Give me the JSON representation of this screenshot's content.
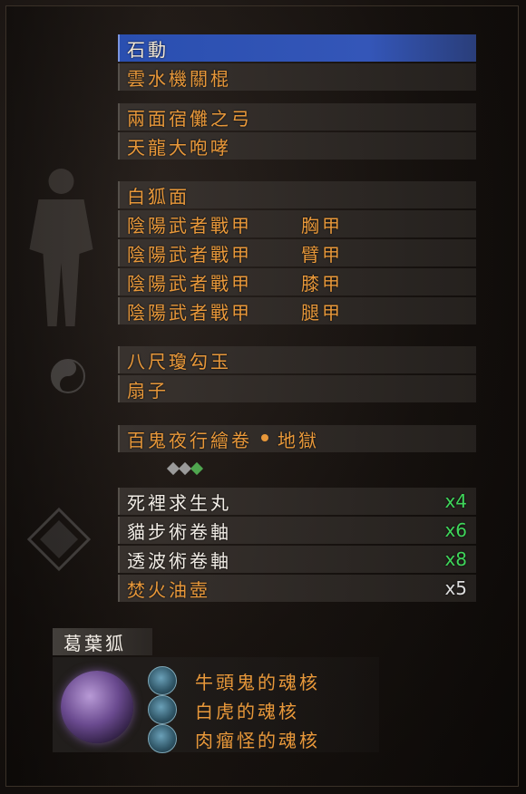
{
  "weapons": [
    "石動",
    "雲水機關棍"
  ],
  "ranged": [
    "兩面宿儺之弓",
    "天龍大咆哮"
  ],
  "armor": [
    {
      "name": "白狐面",
      "part": ""
    },
    {
      "name": "陰陽武者戰甲",
      "part": "胸甲"
    },
    {
      "name": "陰陽武者戰甲",
      "part": "臂甲"
    },
    {
      "name": "陰陽武者戰甲",
      "part": "膝甲"
    },
    {
      "name": "陰陽武者戰甲",
      "part": "腿甲"
    }
  ],
  "accessories": [
    "八尺瓊勾玉",
    "扇子"
  ],
  "scroll": {
    "name": "百鬼夜行繪卷",
    "difficulty": "地獄"
  },
  "gems": [
    "#9a9a9a",
    "#9a9a9a",
    "#4fa64f"
  ],
  "consumables": [
    {
      "name": "死裡求生丸",
      "count": "x4",
      "color": "green"
    },
    {
      "name": "貓步術卷軸",
      "count": "x6",
      "color": "green"
    },
    {
      "name": "透波術卷軸",
      "count": "x8",
      "color": "green"
    },
    {
      "name": "焚火油壺",
      "count": "x5",
      "color": "gray"
    }
  ],
  "guardian": {
    "name": "葛葉狐",
    "cores": [
      "牛頭鬼的魂核",
      "白虎的魂核",
      "肉瘤怪的魂核"
    ]
  },
  "colors": {
    "accent": "#e8983a",
    "selected": "#3456b8",
    "count_green": "#3fd55a"
  }
}
